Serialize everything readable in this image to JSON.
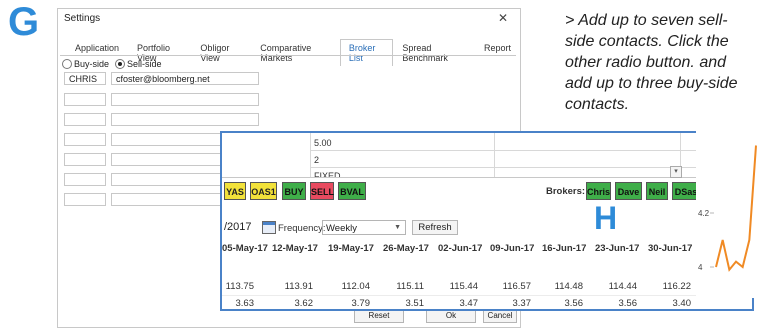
{
  "letters": {
    "g": "G",
    "h": "H"
  },
  "settings": {
    "title": "Settings",
    "close": "✕",
    "tabs": [
      "Application",
      "Portfolio View",
      "Obligor View",
      "Comparative Markets",
      "Broker List",
      "Spread Benchmark",
      "Report"
    ],
    "active_tab": "Broker List",
    "radio_buy": "Buy-side",
    "radio_sell": "Sell-side",
    "selected_radio": "Sell-side",
    "contacts": [
      {
        "name": "CHRIS",
        "email": "cfoster@bloomberg.net"
      },
      {
        "name": "",
        "email": ""
      },
      {
        "name": "",
        "email": ""
      },
      {
        "name": "",
        "email": ""
      },
      {
        "name": "",
        "email": ""
      },
      {
        "name": "",
        "email": ""
      },
      {
        "name": "",
        "email": ""
      }
    ],
    "buttons": {
      "reset": "Reset",
      "ok": "Ok",
      "cancel": "Cancel"
    }
  },
  "annotation": "> Add up to seven sell-side contacts. Click the other radio button. and add up to three buy-side contacts.",
  "overlay": {
    "values": [
      "5.00",
      "2",
      "FIXED"
    ],
    "toolbar": [
      {
        "label": "YAS",
        "color": "#f2e23a",
        "text": "#222"
      },
      {
        "label": "OAS1",
        "color": "#f2e23a",
        "text": "#222"
      },
      {
        "label": "BUY",
        "color": "#3fae49",
        "text": "#111"
      },
      {
        "label": "SELL",
        "color": "#e84a5f",
        "text": "#111"
      },
      {
        "label": "BVAL",
        "color": "#3fae49",
        "text": "#111"
      }
    ],
    "brokers_label": "Brokers:",
    "brokers": [
      "Chris",
      "Dave",
      "Neil",
      "DSas"
    ],
    "broker_color": "#3fae49",
    "date_value": "/2017",
    "frequency_label": "Frequency:",
    "frequency_value": "Weekly",
    "refresh": "Refresh",
    "columns": [
      "05-May-17",
      "12-May-17",
      "19-May-17",
      "26-May-17",
      "02-Jun-17",
      "09-Jun-17",
      "16-Jun-17",
      "23-Jun-17",
      "30-Jun-17"
    ],
    "row1": [
      "113.75",
      "113.91",
      "112.04",
      "115.11",
      "115.44",
      "116.57",
      "114.48",
      "114.44",
      "116.22"
    ],
    "row2": [
      "3.63",
      "3.62",
      "3.79",
      "3.51",
      "3.47",
      "3.37",
      "3.56",
      "3.56",
      "3.40"
    ]
  },
  "chart_data": {
    "type": "line",
    "y_ticks": [
      "4.2",
      "4"
    ],
    "series": [
      {
        "values": [
          4.0,
          4.1,
          3.99,
          4.02,
          4.0,
          4.1,
          4.45
        ],
        "color": "#f08a24"
      }
    ]
  }
}
